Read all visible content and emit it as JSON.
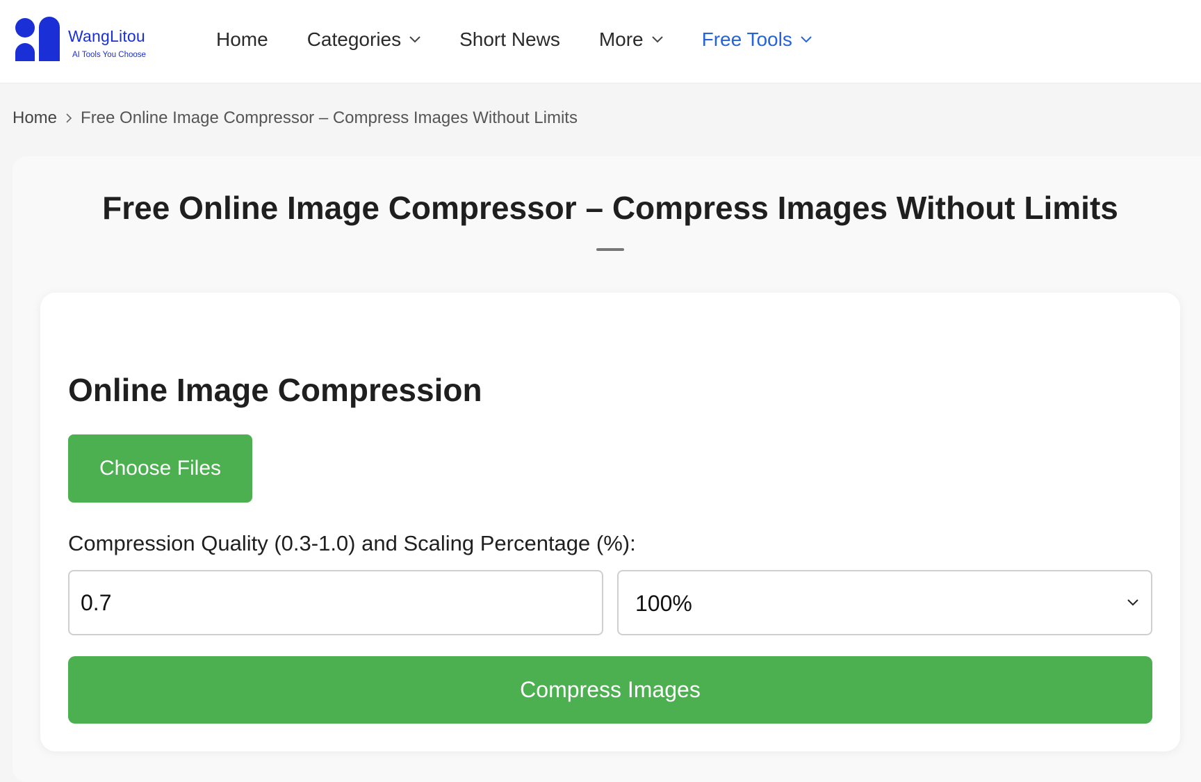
{
  "brand": {
    "name": "WangLitou",
    "tagline": "AI Tools You Choose",
    "color": "#1a2fd6"
  },
  "nav": {
    "items": [
      {
        "label": "Home",
        "dropdown": false
      },
      {
        "label": "Categories",
        "dropdown": true
      },
      {
        "label": "Short News",
        "dropdown": false
      },
      {
        "label": "More",
        "dropdown": true
      },
      {
        "label": "Free Tools",
        "dropdown": true,
        "active": true
      }
    ],
    "active_color": "#2563d9"
  },
  "breadcrumb": {
    "home": "Home",
    "current": "Free Online Image Compressor – Compress Images Without Limits"
  },
  "page": {
    "title": "Free Online Image Compressor – Compress Images Without Limits"
  },
  "tool": {
    "title": "Online Image Compression",
    "choose_files_label": "Choose Files",
    "field_label": "Compression Quality (0.3-1.0) and Scaling Percentage (%):",
    "quality_value": "0.7",
    "scale_selected": "100%",
    "compress_label": "Compress Images",
    "button_color": "#4caf50"
  }
}
